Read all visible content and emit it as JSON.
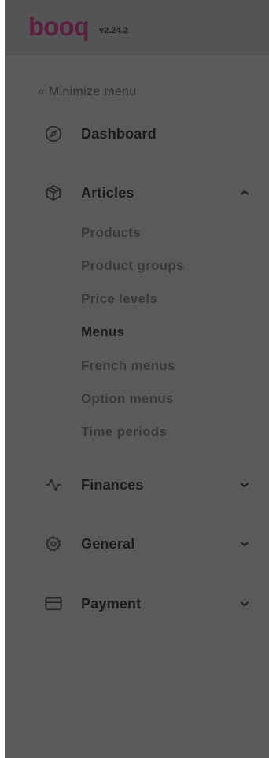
{
  "header": {
    "logo_text": "booq",
    "version": "v2.24.2"
  },
  "menu": {
    "minimize_label": "« Minimize menu",
    "items": [
      {
        "label": "Dashboard",
        "icon": "compass-icon"
      },
      {
        "label": "Articles",
        "icon": "box-icon",
        "expanded": true
      },
      {
        "label": "Finances",
        "icon": "activity-icon",
        "expanded": false
      },
      {
        "label": "General",
        "icon": "gear-icon",
        "expanded": false
      },
      {
        "label": "Payment",
        "icon": "credit-card-icon",
        "expanded": false
      }
    ],
    "articles_sub": [
      "Products",
      "Product groups",
      "Price levels",
      "Menus",
      "French menus",
      "Option menus",
      "Time periods"
    ],
    "active_sub": "Menus"
  },
  "colors": {
    "sidebar_bg": "#5a5a5a",
    "header_bg": "#545454",
    "logo": "#5a1f3f",
    "text": "#1a1a1a",
    "sub_text": "#383838"
  }
}
